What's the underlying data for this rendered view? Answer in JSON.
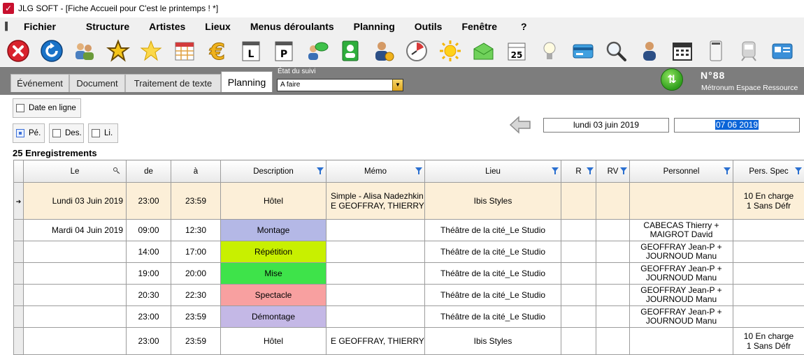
{
  "window": {
    "title": "JLG SOFT - [Fiche Accueil pour C'est le printemps ! *]"
  },
  "menu": [
    "Fichier",
    "Structure",
    "Artistes",
    "Lieux",
    "Menus déroulants",
    "Planning",
    "Outils",
    "Fenêtre",
    "?"
  ],
  "toolbar": [
    "close-icon",
    "refresh-icon",
    "users-icon",
    "star-outline-icon",
    "star-icon",
    "calendar-grid-icon",
    "euro-icon",
    "l-card-icon",
    "p-card-icon",
    "chat-icon",
    "contact-book-icon",
    "user-money-icon",
    "clock-icon",
    "sun-icon",
    "envelope-icon",
    "calendar-25-icon",
    "lightbulb-icon",
    "credit-card-icon",
    "magnifier-icon",
    "person-icon",
    "calendar-icon",
    "phone-icon",
    "train-icon",
    "id-card-icon"
  ],
  "tabs": [
    {
      "label": "Événement",
      "active": false
    },
    {
      "label": "Document",
      "active": false
    },
    {
      "label": "Traitement de texte",
      "active": false
    },
    {
      "label": "Planning",
      "active": true
    }
  ],
  "suivi": {
    "label": "État du suivi",
    "value": "A faire"
  },
  "record": {
    "number": "N°88",
    "subtitle": "Métronum  Espace Ressource"
  },
  "filters": {
    "date_en_ligne": "Date en ligne",
    "pe": "Pé.",
    "des": "Des.",
    "li": "Li."
  },
  "dates": {
    "display": "lundi 03 juin 2019",
    "input": "07 06 2019"
  },
  "records_count": "25 Enregistrements",
  "columns": [
    "Le",
    "de",
    "à",
    "Description",
    "Mémo",
    "Lieu",
    "R",
    "RV",
    "Personnel",
    "Pers. Spec"
  ],
  "rows": [
    {
      "le": "Lundi 03 Juin 2019",
      "de": "23:00",
      "a": "23:59",
      "desc": "Hôtel",
      "desc_color": "",
      "memo1": "Simple - Alisa Nadezhkin",
      "memo2": "E GEOFFRAY, THIERRY",
      "lieu": "Ibis Styles",
      "pers1": "",
      "pers2": "",
      "spec1": "10 En charge",
      "spec2": "1 Sans Défr"
    },
    {
      "le": "Mardi 04 Juin 2019",
      "de": "09:00",
      "a": "12:30",
      "desc": "Montage",
      "desc_color": "#b4b8e6",
      "memo1": "",
      "memo2": "",
      "lieu": "Théâtre de la cité_Le Studio",
      "pers1": "CABECAS Thierry +",
      "pers2": "MAIGROT David",
      "spec1": "",
      "spec2": ""
    },
    {
      "le": "",
      "de": "14:00",
      "a": "17:00",
      "desc": "Répétition",
      "desc_color": "#c8f000",
      "memo1": "",
      "memo2": "",
      "lieu": "Théâtre de la cité_Le Studio",
      "pers1": "GEOFFRAY Jean-P +",
      "pers2": "JOURNOUD Manu",
      "spec1": "",
      "spec2": ""
    },
    {
      "le": "",
      "de": "19:00",
      "a": "20:00",
      "desc": "Mise",
      "desc_color": "#3ee34a",
      "memo1": "",
      "memo2": "",
      "lieu": "Théâtre de la cité_Le Studio",
      "pers1": "GEOFFRAY Jean-P +",
      "pers2": "JOURNOUD Manu",
      "spec1": "",
      "spec2": ""
    },
    {
      "le": "",
      "de": "20:30",
      "a": "22:30",
      "desc": "Spectacle",
      "desc_color": "#f8a0a0",
      "memo1": "",
      "memo2": "",
      "lieu": "Théâtre de la cité_Le Studio",
      "pers1": "GEOFFRAY Jean-P +",
      "pers2": "JOURNOUD Manu",
      "spec1": "",
      "spec2": ""
    },
    {
      "le": "",
      "de": "23:00",
      "a": "23:59",
      "desc": "Démontage",
      "desc_color": "#c4b8e6",
      "memo1": "",
      "memo2": "",
      "lieu": "Théâtre de la cité_Le Studio",
      "pers1": "GEOFFRAY Jean-P +",
      "pers2": "JOURNOUD Manu",
      "spec1": "",
      "spec2": ""
    },
    {
      "le": "",
      "de": "23:00",
      "a": "23:59",
      "desc": "Hôtel",
      "desc_color": "",
      "memo1": "E GEOFFRAY, THIERRY",
      "memo2": "",
      "lieu": "Ibis Styles",
      "pers1": "",
      "pers2": "",
      "spec1": "10 En charge",
      "spec2": "1 Sans Défr"
    }
  ],
  "colors": {
    "tabstrip": "#7d7d7d",
    "selected_row": "#fcefd8",
    "accent": "#0a64d8"
  }
}
